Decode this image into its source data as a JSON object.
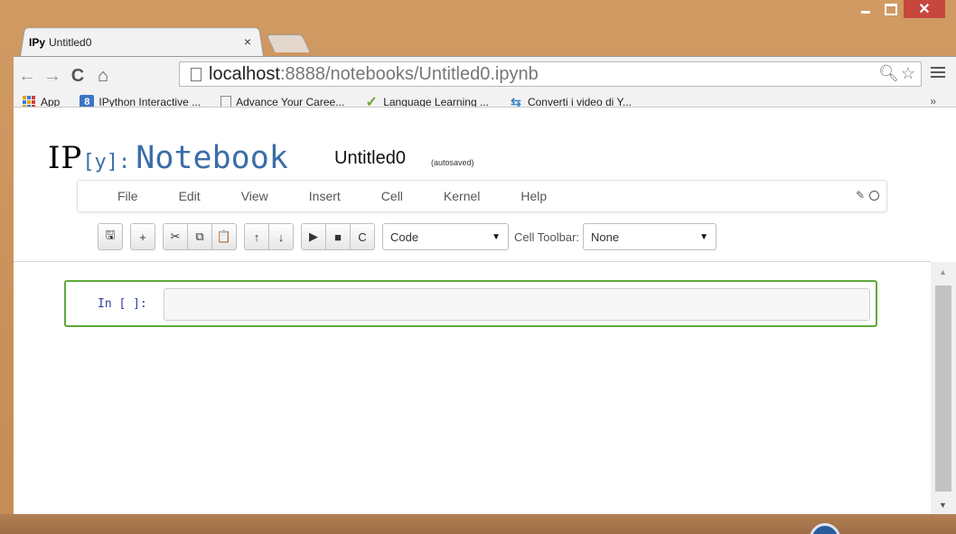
{
  "browser": {
    "tab": {
      "favicon": "IPy",
      "title": "Untitled0",
      "close": "×"
    },
    "window_controls": {
      "close": "✕"
    },
    "nav": {
      "back": "←",
      "forward": "→",
      "reload": "C",
      "home": "⌂"
    },
    "url": {
      "host": "localhost",
      "rest": ":8888/notebooks/Untitled0.ipynb"
    },
    "omnibox_icons": {
      "zoom": "🔍︎",
      "star": "☆"
    },
    "bookmarks": {
      "apps": "App",
      "items": [
        {
          "icon": "8",
          "label": "IPython Interactive ..."
        },
        {
          "icon": "",
          "label": "Advance Your Caree..."
        },
        {
          "icon": "✓",
          "label": "Language Learning ..."
        },
        {
          "icon": "⇆",
          "label": "Converti i video di Y..."
        }
      ],
      "more": "»"
    }
  },
  "notebook": {
    "logo_ip": "IP",
    "logo_y": "[y]:",
    "logo_nb": "Notebook",
    "name": "Untitled0",
    "autosave": "(autosaved)",
    "menu": [
      "File",
      "Edit",
      "View",
      "Insert",
      "Cell",
      "Kernel",
      "Help"
    ],
    "toolbar": {
      "save": "🖫",
      "insert": "+",
      "cut": "✂",
      "copy": "⧉",
      "paste": "📋",
      "move_up": "↑",
      "move_down": "↓",
      "run": "▶",
      "stop": "■",
      "restart": "C",
      "cell_type": "Code",
      "cell_toolbar_label": "Cell Toolbar:",
      "cell_toolbar_value": "None",
      "caret": "▼"
    },
    "cell": {
      "prompt": "In [ ]:"
    }
  },
  "scrollbar": {
    "up": "▲",
    "down": "▼"
  }
}
